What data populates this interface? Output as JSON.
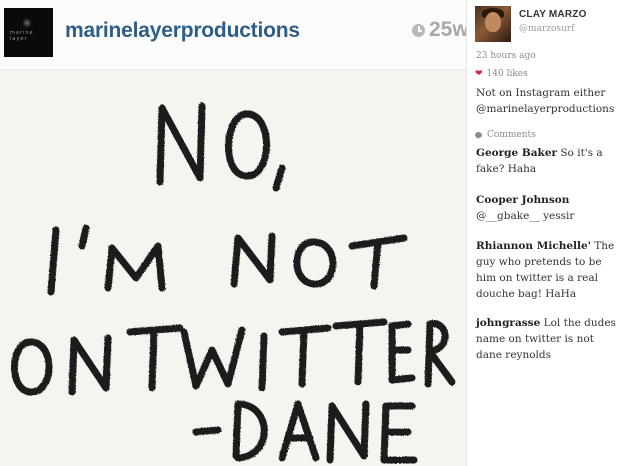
{
  "post": {
    "username": "marinelayerproductions",
    "time_ago": "25w",
    "avatar_icon": "avatar-dark-logo",
    "avatar_text": "marine layer",
    "image_text_lines": [
      "NO,",
      "I'M NOT",
      "ON TWITTER",
      "-DANE"
    ]
  },
  "sidebar": {
    "display_name": "CLAY MARZO",
    "handle": "@marzosurf",
    "time_ago": "23 hours ago",
    "likes": "140 likes",
    "caption": "Not on Instagram either @marinelayerproductions",
    "comments_heading": "Comments",
    "comments": [
      {
        "author": "George Baker",
        "text": " So it's a fake? Haha"
      },
      {
        "author": "Cooper Johnson",
        "text": "@__gbake__ yessir"
      },
      {
        "author": "Rhiannon Michelle'",
        "text": " The guy who pretends to be him on twitter is a real douche bag! HaHa"
      },
      {
        "author": "johngrasse",
        "text": " Lol the dudes name on twitter is not dane reynolds"
      }
    ]
  },
  "colors": {
    "username_blue": "#2e5e86",
    "heart_red": "#d0284a",
    "muted_gray": "#8a8a8a"
  }
}
